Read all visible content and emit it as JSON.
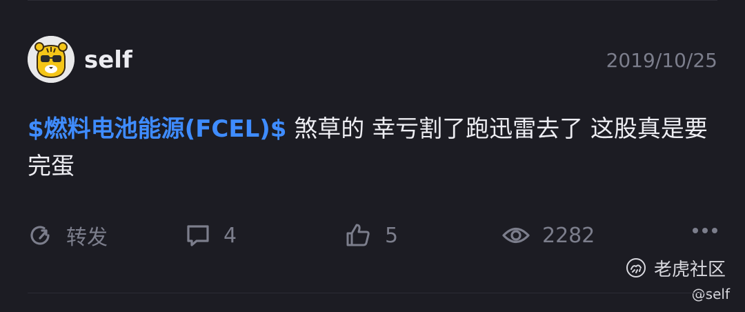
{
  "post": {
    "username": "self",
    "date": "2019/10/25",
    "stock_tag": "$燃料电池能源(FCEL)$",
    "body_text": " 煞草的 幸亏割了跑迅雷去了 这股真是要完蛋"
  },
  "actions": {
    "repost_label": "转发",
    "comment_count": "4",
    "like_count": "5",
    "view_count": "2282"
  },
  "watermark": {
    "brand": "老虎社区",
    "handle": "@self"
  },
  "colors": {
    "background": "#1c1c23",
    "accent_link": "#3f8cff",
    "muted": "#7c7e8c"
  },
  "icons": [
    "tiger-avatar-icon",
    "repost-icon",
    "comment-icon",
    "like-icon",
    "views-icon",
    "more-icon",
    "tiger-logo-icon"
  ]
}
